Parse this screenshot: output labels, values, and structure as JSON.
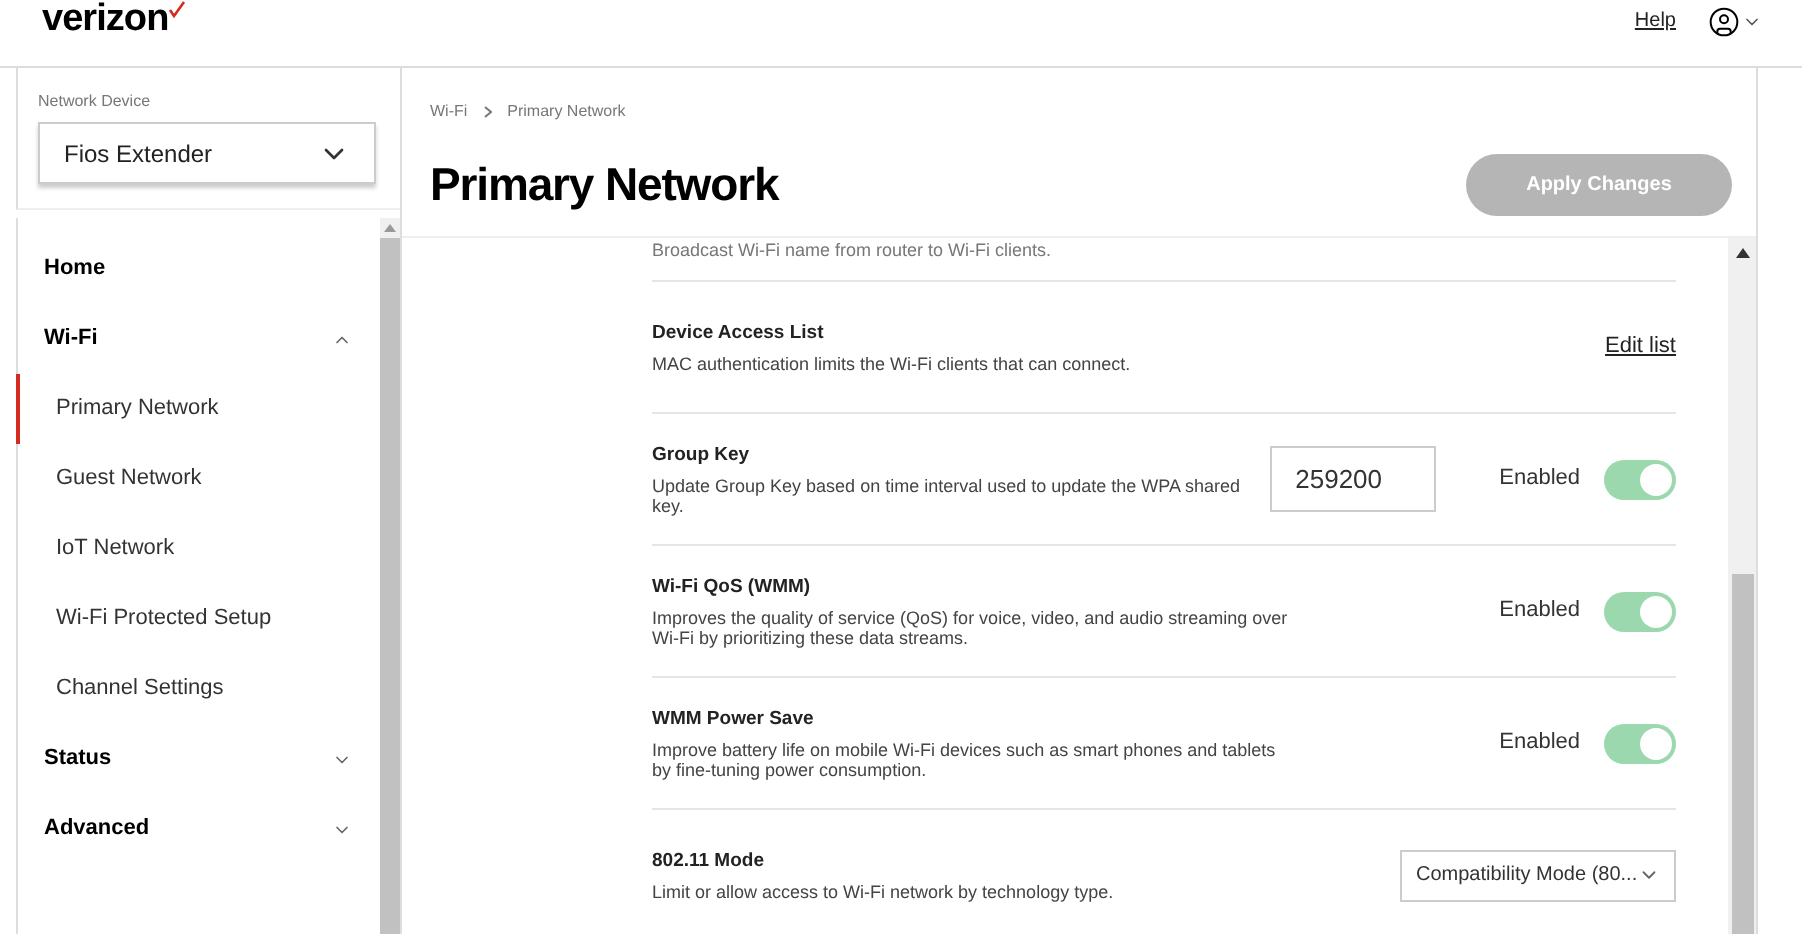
{
  "header": {
    "logo": "verizon",
    "help": "Help"
  },
  "sidebar": {
    "device_label": "Network Device",
    "device": "Fios Extender",
    "items": [
      {
        "label": "Home"
      },
      {
        "label": "Wi-Fi",
        "expanded": true,
        "children": [
          {
            "label": "Primary Network",
            "selected": true
          },
          {
            "label": "Guest Network",
            "selected": false
          },
          {
            "label": "IoT Network",
            "selected": false
          },
          {
            "label": "Wi-Fi Protected Setup",
            "selected": false
          },
          {
            "label": "Channel Settings",
            "selected": false
          }
        ]
      },
      {
        "label": "Status",
        "expanded": false
      },
      {
        "label": "Advanced",
        "expanded": false
      }
    ]
  },
  "breadcrumb": [
    "Wi-Fi",
    "Primary Network"
  ],
  "title": "Primary Network",
  "apply_button": {
    "label": "Apply Changes",
    "disabled": true
  },
  "partial_text": "Broadcast Wi-Fi name from router to Wi-Fi clients.",
  "settings": [
    {
      "kind": "link",
      "title": "Device Access List",
      "description": "MAC authentication limits the Wi-Fi clients that can connect.",
      "link": "Edit list"
    },
    {
      "kind": "input_toggle",
      "title": "Group Key",
      "description": "Update Group Key based on time interval used to update the WPA shared key.",
      "value": "259200",
      "toggle_label": "Enabled",
      "on": true
    },
    {
      "kind": "toggle",
      "title": "Wi-Fi QoS (WMM)",
      "description": "Improves the quality of service (QoS) for voice, video, and audio streaming over Wi-Fi by prioritizing these data streams.",
      "toggle_label": "Enabled",
      "on": true
    },
    {
      "kind": "toggle",
      "title": "WMM Power Save",
      "description": "Improve battery life on mobile Wi-Fi devices such as smart phones and tablets by fine-tuning power consumption.",
      "toggle_label": "Enabled",
      "on": true
    },
    {
      "kind": "select",
      "title": "802.11 Mode",
      "description": "Limit or allow access to Wi-Fi network by technology type.",
      "value": "Compatibility Mode (80..."
    }
  ]
}
